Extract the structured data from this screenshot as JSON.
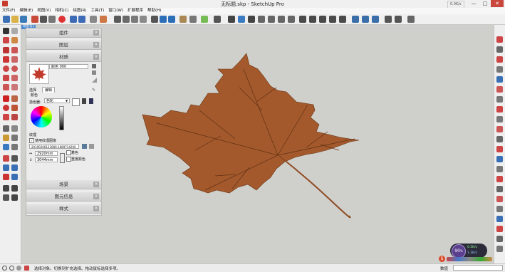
{
  "window": {
    "title": "无标题.skp - SketchUp Pro",
    "min": "—",
    "max": "□",
    "close": "✕",
    "net_badge": "0.0K/s"
  },
  "menu": [
    "文件(F)",
    "编辑(E)",
    "视图(V)",
    "相机(C)",
    "绘图(R)",
    "工具(T)",
    "窗口(W)",
    "扩展程序",
    "帮助(H)"
  ],
  "scene_tab": "场景号1",
  "tray": {
    "components": "组件",
    "layers": "图层",
    "materials": "材质",
    "material_name": "颜色 000",
    "tab_select": "选择",
    "tab_edit": "编辑",
    "color_label": "颜色",
    "picker_label": "拾色器:",
    "picker_value": "色轮",
    "texture_label": "纹理",
    "use_texture": "使用纹理图像",
    "texture_file": "20190206123089-1689714290",
    "width_value": "2920mm",
    "height_value": "3044mm",
    "colorize": "着色",
    "reset_color": "重置颜色",
    "scenes": "场景",
    "entity_info": "图元信息",
    "styles": "样式",
    "close_glyph": "×"
  },
  "status": {
    "hint": "选择对象。切换到扩充选择。拖动鼠标选择多项。",
    "measure_label": "数值"
  },
  "gauge": {
    "percent": "90",
    "unit": "%",
    "up": "0.5K/s",
    "down": "1.3K/s"
  },
  "colors": {
    "leaf": "#a3592c",
    "leaf_vein": "#5f2f13",
    "viewport": "#cfcfcb",
    "accent": "#2e7bd4"
  },
  "icons": [
    "select-icon",
    "eraser-icon",
    "paint-bucket-icon",
    "line-icon",
    "arc-icon",
    "rectangle-icon",
    "circle-icon",
    "push-pull-icon",
    "move-icon",
    "rotate-icon",
    "scale-icon",
    "offset-icon",
    "tape-measure-icon",
    "text-icon",
    "orbit-icon",
    "pan-icon",
    "zoom-icon",
    "zoom-extents-icon",
    "walk-icon",
    "look-around-icon"
  ]
}
